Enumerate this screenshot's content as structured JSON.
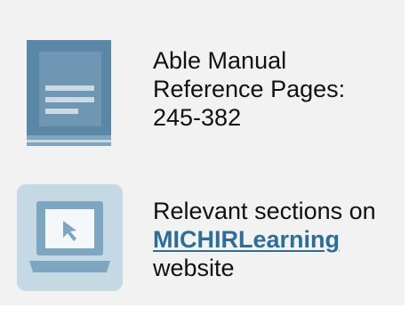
{
  "reference": {
    "line1": "Able Manual",
    "line2": "Reference Pages:",
    "line3": "245-382"
  },
  "web": {
    "line1": "Relevant sections on",
    "link_label": "MICHIRLearning",
    "line3": "website"
  },
  "colors": {
    "panel_background": "#f2f2f2",
    "book_icon": "#5a87a5",
    "laptop_frame": "#c5d9e5",
    "laptop_body": "#7fa6c0",
    "link": "#2e6d95"
  },
  "icons": {
    "reference": "book-icon",
    "website": "laptop-cursor-icon"
  }
}
